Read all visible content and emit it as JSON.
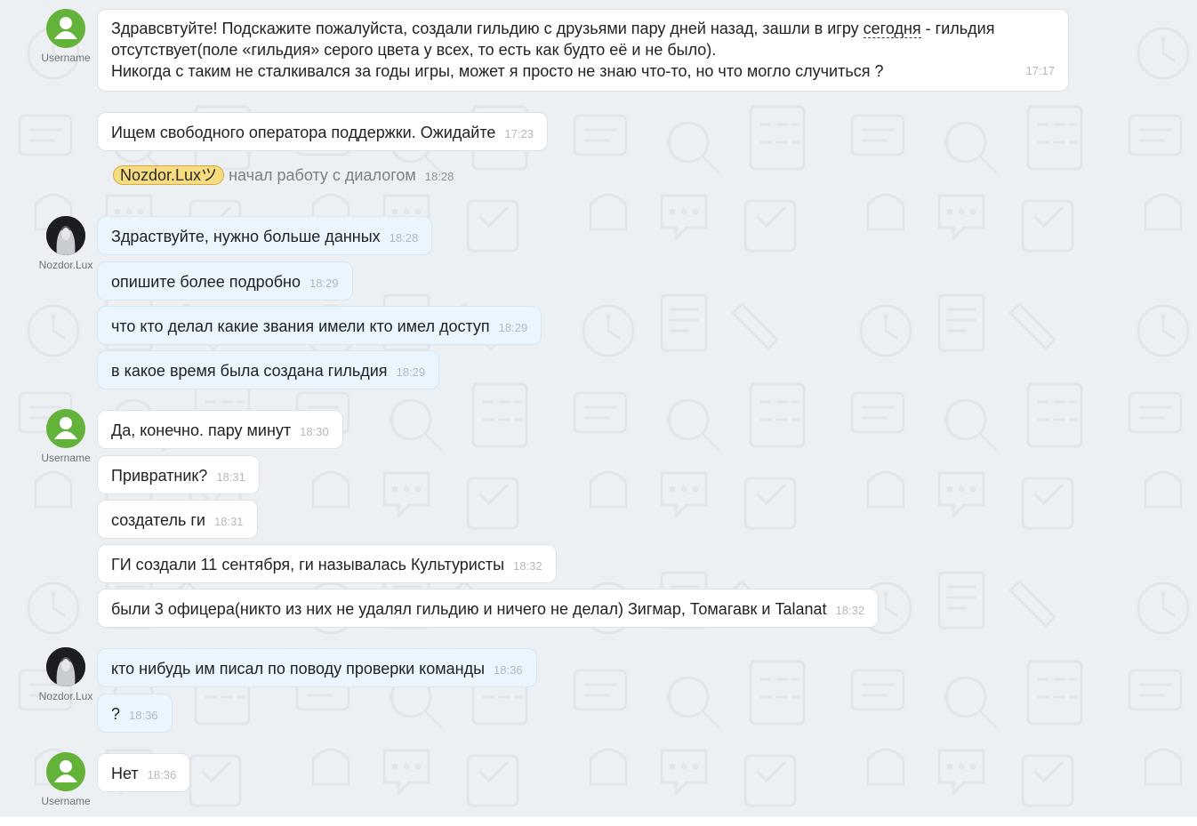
{
  "colors": {
    "chat_background": "#edf0f3",
    "user_bubble": "#ffffff",
    "operator_bubble": "#eaf5fd",
    "user_avatar": "#63b23a",
    "operator_badge": "#f7dd7f",
    "timestamp": "#b3b9be"
  },
  "messages": [
    {
      "author": "Username",
      "avatar_icon": "user-silhouette-icon",
      "lines": [
        "Здравсвтуйте! Подскажите пожалуйста, создали гильдию с друзьями пару дней назад, зашли в игру ",
        "сегодня",
        " - гильдия отсутствует(поле «гильдия» серого цвета у всех, то есть как будто её и не было).",
        "Никогда с таким не сталкивался за годы игры, может я просто не знаю что-то, но что могло случиться ?"
      ],
      "time": "17:17"
    },
    {
      "text": "Ищем свободного оператора поддержки. Ожидайте",
      "time": "17:23"
    },
    {
      "system": true,
      "operator_name": "Nozdor.Luxツ",
      "text": "начал работу с диалогом",
      "time": "18:28"
    },
    {
      "author": "Nozdor.Lux",
      "avatar_icon": "operator-avatar-photo-icon",
      "text": "Здраствуйте, нужно больше данных",
      "time": "18:28"
    },
    {
      "text": "опишите более подробно",
      "time": "18:29"
    },
    {
      "text": "что кто делал какие звания имели кто имел доступ",
      "time": "18:29"
    },
    {
      "text": "в какое время была создана гильдия",
      "time": "18:29"
    },
    {
      "author": "Username",
      "avatar_icon": "user-silhouette-icon",
      "text": "Да, конечно. пару минут",
      "time": "18:30"
    },
    {
      "text": "Привратник?",
      "time": "18:31"
    },
    {
      "text": "создатель ги",
      "time": "18:31"
    },
    {
      "text": "ГИ создали 11 сентября, ги называлась Культуристы",
      "time": "18:32"
    },
    {
      "text": "были 3 офицера(никто из них не удалял гильдию и ничего не делал) Зигмар, Томагавк и Talanat",
      "time": "18:32"
    },
    {
      "author": "Nozdor.Lux",
      "avatar_icon": "operator-avatar-photo-icon",
      "text": "кто нибудь им писал по поводу проверки команды",
      "time": "18:36"
    },
    {
      "text": "?",
      "time": "18:36"
    },
    {
      "author": "Username",
      "avatar_icon": "user-silhouette-icon",
      "text": "Нет",
      "time": "18:36"
    }
  ]
}
